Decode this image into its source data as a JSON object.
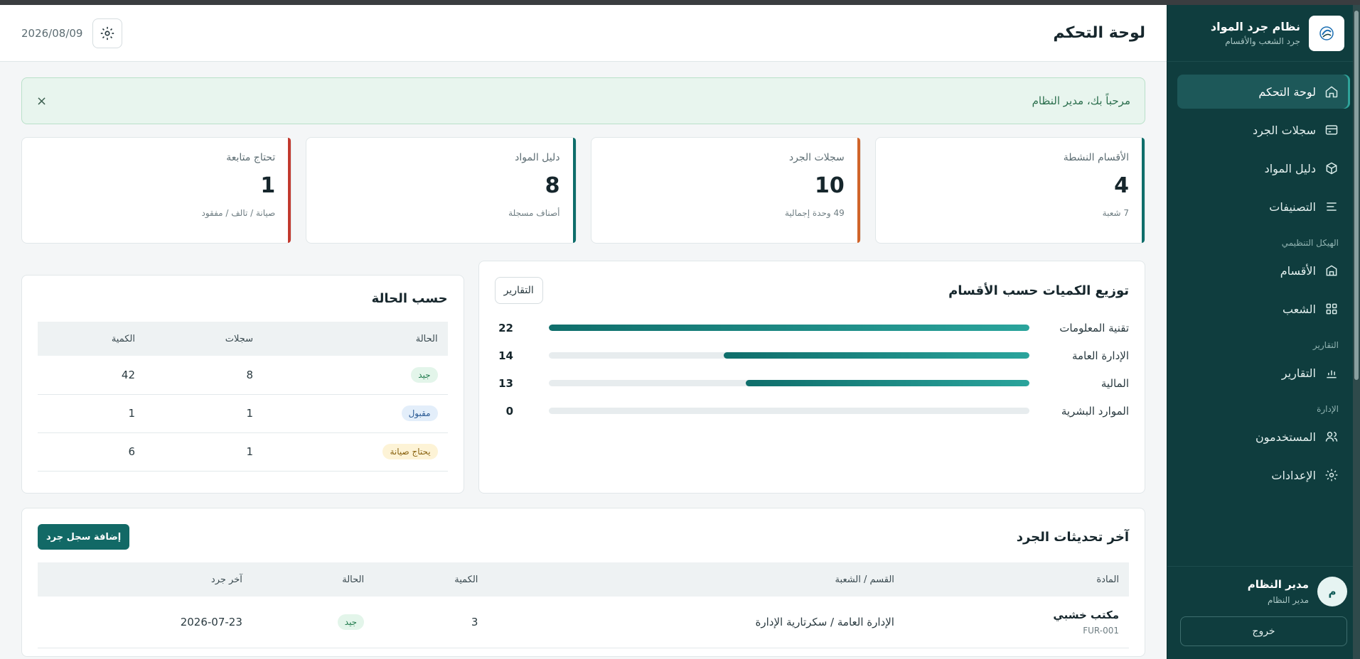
{
  "brand": {
    "title": "نظام جرد المواد",
    "subtitle": "جرد الشعب والأقسام"
  },
  "sidebar": {
    "items": [
      {
        "label": "لوحة التحكم",
        "icon": "home-icon",
        "active": true
      },
      {
        "label": "سجلات الجرد",
        "icon": "records-icon"
      },
      {
        "label": "دليل المواد",
        "icon": "box-icon"
      },
      {
        "label": "التصنيفات",
        "icon": "list-icon"
      }
    ],
    "group_org": "الهيكل التنظيمي",
    "org_items": [
      {
        "label": "الأقسام",
        "icon": "building-icon"
      },
      {
        "label": "الشعب",
        "icon": "grid-icon"
      }
    ],
    "group_reports": "التقارير",
    "reports_items": [
      {
        "label": "التقارير",
        "icon": "chart-icon"
      }
    ],
    "group_admin": "الإدارة",
    "admin_items": [
      {
        "label": "المستخدمون",
        "icon": "users-icon"
      },
      {
        "label": "الإعدادات",
        "icon": "gear-icon"
      }
    ],
    "user": {
      "initial": "م",
      "name": "مدير النظام",
      "role": "مدير النظام"
    },
    "logout_label": "خروج"
  },
  "header": {
    "title": "لوحة التحكم",
    "date": "2026/08/09"
  },
  "alert": {
    "message": "مرحباً بك، مدير النظام",
    "close": "×"
  },
  "stats": [
    {
      "label": "الأقسام النشطة",
      "value": "4",
      "sub": "7 شعبة",
      "accent": "#0f6e6b"
    },
    {
      "label": "سجلات الجرد",
      "value": "10",
      "sub": "49 وحدة إجمالية",
      "accent": "#d0642a"
    },
    {
      "label": "دليل المواد",
      "value": "8",
      "sub": "أصناف مسجلة",
      "accent": "#0f6e6b"
    },
    {
      "label": "تحتاج متابعة",
      "value": "1",
      "sub": "صيانة / تالف / مفقود",
      "accent": "#c23a2f"
    }
  ],
  "distribution": {
    "title": "توزيع الكميات حسب الأقسام",
    "button": "التقارير",
    "max": 22,
    "rows": [
      {
        "label": "تقنية المعلومات",
        "value": 22
      },
      {
        "label": "الإدارة العامة",
        "value": 14
      },
      {
        "label": "المالية",
        "value": 13
      },
      {
        "label": "الموارد البشرية",
        "value": 0
      }
    ]
  },
  "by_status": {
    "title": "حسب الحالة",
    "headers": {
      "status": "الحالة",
      "records": "سجلات",
      "qty": "الكمية"
    },
    "rows": [
      {
        "status": "جيد",
        "kind": "good",
        "records": "8",
        "qty": "42"
      },
      {
        "status": "مقبول",
        "kind": "ok",
        "records": "1",
        "qty": "1"
      },
      {
        "status": "يحتاج صيانة",
        "kind": "maint",
        "records": "1",
        "qty": "6"
      }
    ]
  },
  "recent": {
    "title": "آخر تحديثات الجرد",
    "add_button": "إضافة سجل جرد",
    "headers": {
      "item": "المادة",
      "dept": "القسم / الشعبة",
      "qty": "الكمية",
      "status": "الحالة",
      "last": "آخر جرد"
    },
    "rows": [
      {
        "name": "مكتب خشبي",
        "code": "FUR-001",
        "dept": "الإدارة العامة / سكرتارية الإدارة",
        "qty": "3",
        "status": "جيد",
        "last": "2026-07-23"
      }
    ]
  }
}
